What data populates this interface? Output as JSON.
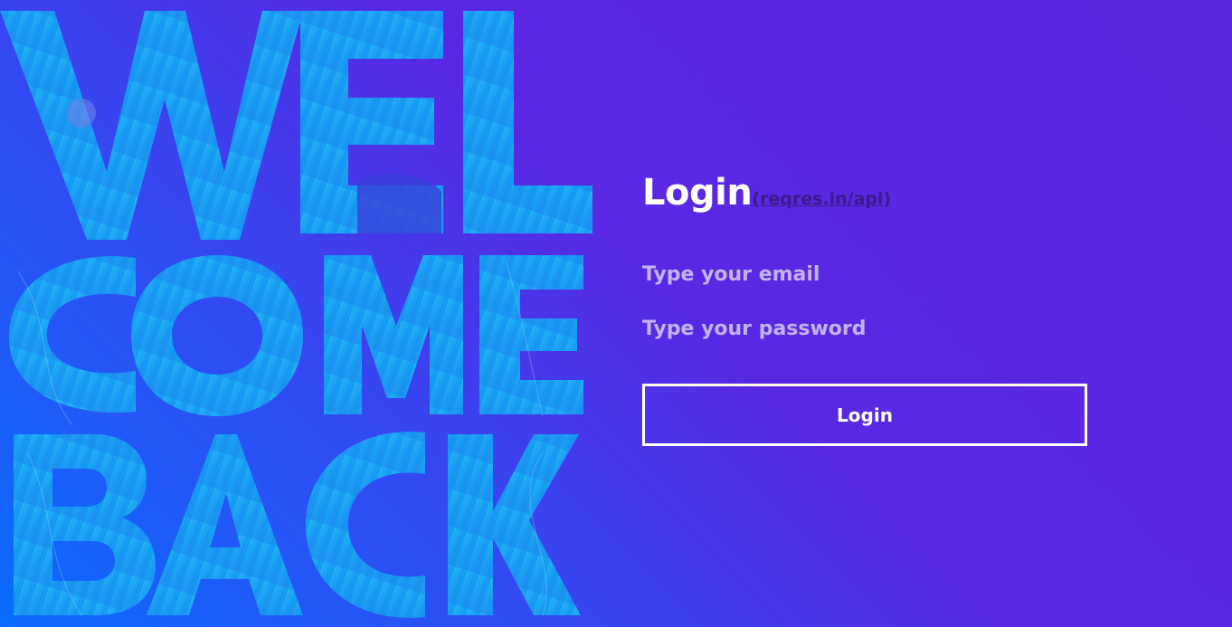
{
  "hero": {
    "lines": [
      "WEL",
      "COME",
      "BACK"
    ]
  },
  "login": {
    "title": "Login",
    "api_link": "(reqres.in/api)",
    "email_placeholder": "Type your email",
    "password_placeholder": "Type your password",
    "button_label": "Login"
  },
  "colors": {
    "background_start": "#0a6cff",
    "background_end": "#5b26e0",
    "letter_fill": "#17a9f5",
    "link": "#3b1a8a",
    "placeholder": "#c2b3f2"
  }
}
